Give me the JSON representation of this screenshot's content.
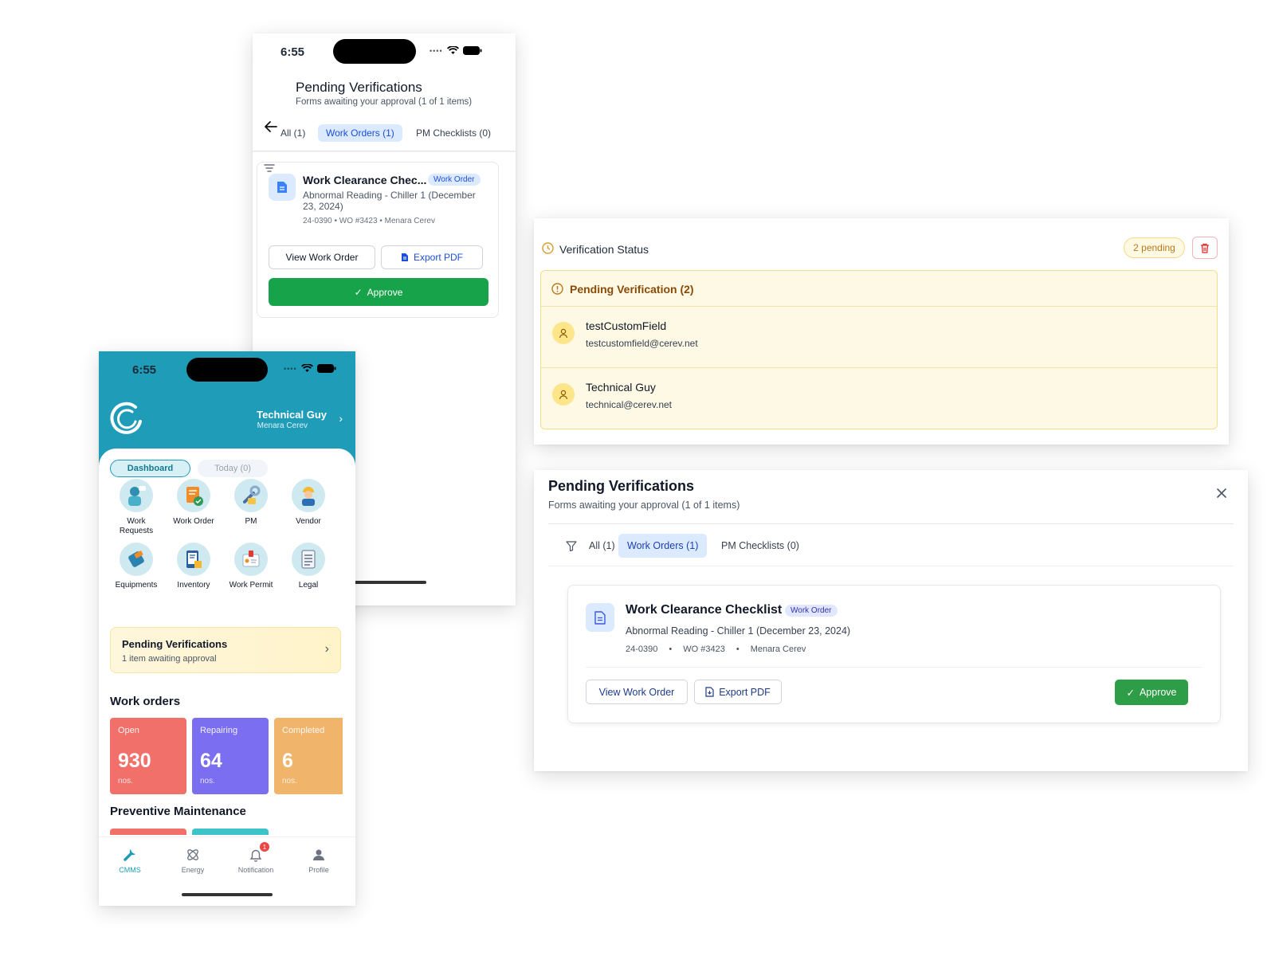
{
  "phone1": {
    "time": "6:55",
    "title": "Pending Verifications",
    "subtitle": "Forms awaiting your approval (1 of 1 items)",
    "tabs": [
      {
        "label": "All (1)",
        "active": false
      },
      {
        "label": "Work Orders (1)",
        "active": true
      },
      {
        "label": "PM Checklists (0)",
        "active": false
      }
    ],
    "card": {
      "title": "Work Clearance Chec...",
      "type_pill": "Work Order",
      "description": "Abnormal Reading - Chiller 1 (December 23, 2024)",
      "meta": "24-0390 • WO #3423 • Menara Cerev",
      "view_label": "View Work Order",
      "export_label": "Export PDF",
      "approve_label": "Approve"
    }
  },
  "phone2": {
    "time": "6:55",
    "user_name": "Technical Guy",
    "user_site": "Menara Cerev",
    "segments": {
      "dashboard": "Dashboard",
      "today": "Today (0)"
    },
    "grid": [
      {
        "label": "Work Requests",
        "icon": "work-requests-icon"
      },
      {
        "label": "Work Order",
        "icon": "work-order-icon"
      },
      {
        "label": "PM",
        "icon": "pm-icon"
      },
      {
        "label": "Vendor",
        "icon": "vendor-icon"
      },
      {
        "label": "Equipments",
        "icon": "equipments-icon"
      },
      {
        "label": "Inventory",
        "icon": "inventory-icon"
      },
      {
        "label": "Work Permit",
        "icon": "work-permit-icon"
      },
      {
        "label": "Legal",
        "icon": "legal-icon"
      }
    ],
    "pending_card": {
      "title": "Pending Verifications",
      "subtitle": "1 item awaiting approval"
    },
    "work_orders_title": "Work orders",
    "stats": [
      {
        "label": "Open",
        "value": "930",
        "unit": "nos.",
        "color": "#f2706a"
      },
      {
        "label": "Repairing",
        "value": "64",
        "unit": "nos.",
        "color": "#7b6ef0"
      },
      {
        "label": "Completed",
        "value": "6",
        "unit": "nos.",
        "color": "#f0b46b"
      }
    ],
    "pm_title": "Preventive Maintenance",
    "tabbar": [
      {
        "label": "CMMS",
        "icon": "wrench-icon",
        "active": true
      },
      {
        "label": "Energy",
        "icon": "energy-icon",
        "active": false
      },
      {
        "label": "Notification",
        "icon": "bell-icon",
        "active": false,
        "badge": "1"
      },
      {
        "label": "Profile",
        "icon": "profile-icon",
        "active": false
      }
    ]
  },
  "verification_status": {
    "title": "Verification Status",
    "pending_badge": "2 pending",
    "box_title": "Pending Verification (2)",
    "users": [
      {
        "name": "testCustomField",
        "email": "testcustomfield@cerev.net"
      },
      {
        "name": "Technical Guy",
        "email": "technical@cerev.net"
      }
    ]
  },
  "dialog": {
    "title": "Pending Verifications",
    "subtitle": "Forms awaiting your approval (1 of 1 items)",
    "tabs": [
      {
        "label": "All (1)",
        "active": false
      },
      {
        "label": "Work Orders (1)",
        "active": true
      },
      {
        "label": "PM Checklists (0)",
        "active": false
      }
    ],
    "card": {
      "title": "Work Clearance Checklist",
      "type_pill": "Work Order",
      "description": "Abnormal Reading - Chiller 1 (December 23, 2024)",
      "meta": [
        "24-0390",
        "•",
        "WO #3423",
        "•",
        "Menara Cerev"
      ],
      "view_label": "View Work Order",
      "export_label": "Export PDF",
      "approve_label": "Approve"
    }
  },
  "colors": {
    "brand_teal": "#1f9cb8",
    "approve_green": "#16a34a",
    "pending_yellow": "#fef9e4",
    "active_tab_blue": "#dbeafe"
  }
}
